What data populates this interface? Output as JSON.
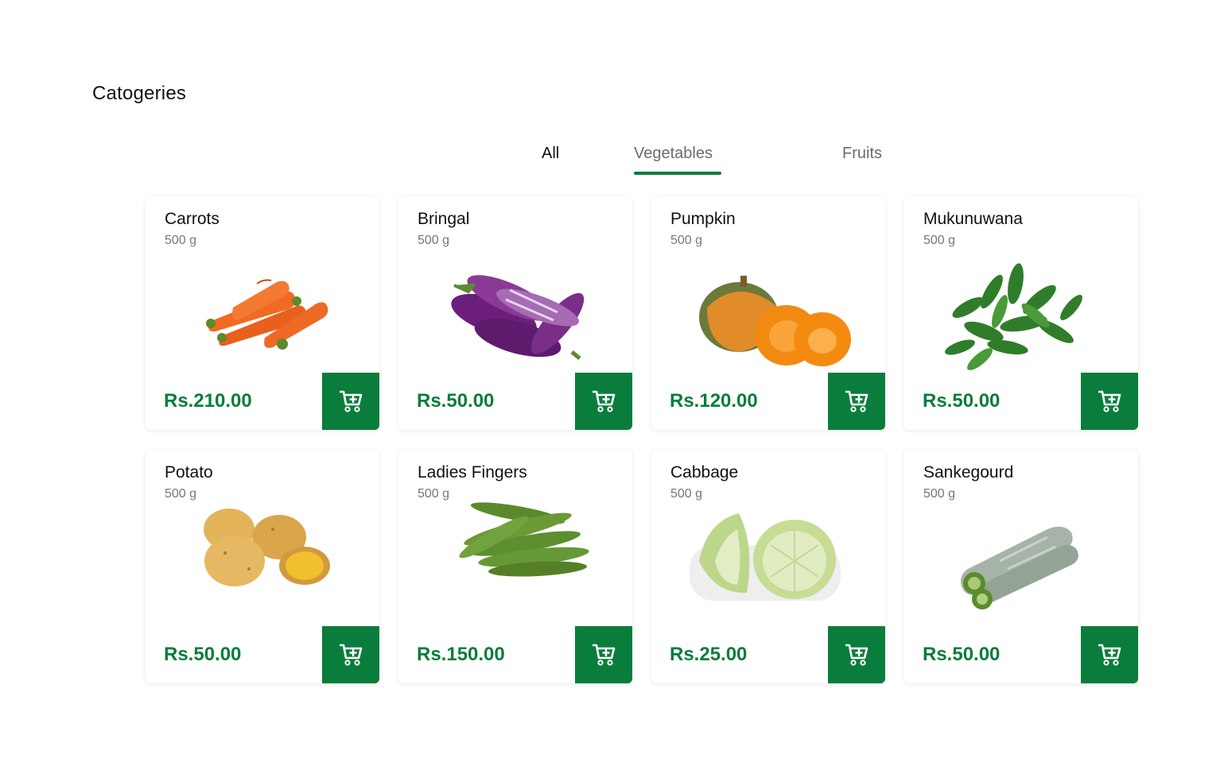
{
  "section": {
    "title": "Catogeries"
  },
  "tabs": [
    {
      "label": "All",
      "active": false
    },
    {
      "label": "Vegetables",
      "active": true
    },
    {
      "label": "Fruits",
      "active": false
    }
  ],
  "colors": {
    "accent": "#0a7d3c",
    "muted": "#777777"
  },
  "products": [
    {
      "name": "Carrots",
      "weight": "500 g",
      "price": "Rs.210.00",
      "image": "carrots"
    },
    {
      "name": "Bringal",
      "weight": "500 g",
      "price": "Rs.50.00",
      "image": "eggplant"
    },
    {
      "name": "Pumpkin",
      "weight": "500 g",
      "price": "Rs.120.00",
      "image": "pumpkin"
    },
    {
      "name": "Mukunuwana",
      "weight": "500 g",
      "price": "Rs.50.00",
      "image": "leafy-greens"
    },
    {
      "name": "Potato",
      "weight": "500 g",
      "price": "Rs.50.00",
      "image": "potato"
    },
    {
      "name": "Ladies Fingers",
      "weight": "500 g",
      "price": "Rs.150.00",
      "image": "okra"
    },
    {
      "name": "Cabbage",
      "weight": "500 g",
      "price": "Rs.25.00",
      "image": "cabbage"
    },
    {
      "name": "Sankegourd",
      "weight": "500 g",
      "price": "Rs.50.00",
      "image": "snake-gourd"
    }
  ],
  "cart_icon": "cart-add-icon"
}
